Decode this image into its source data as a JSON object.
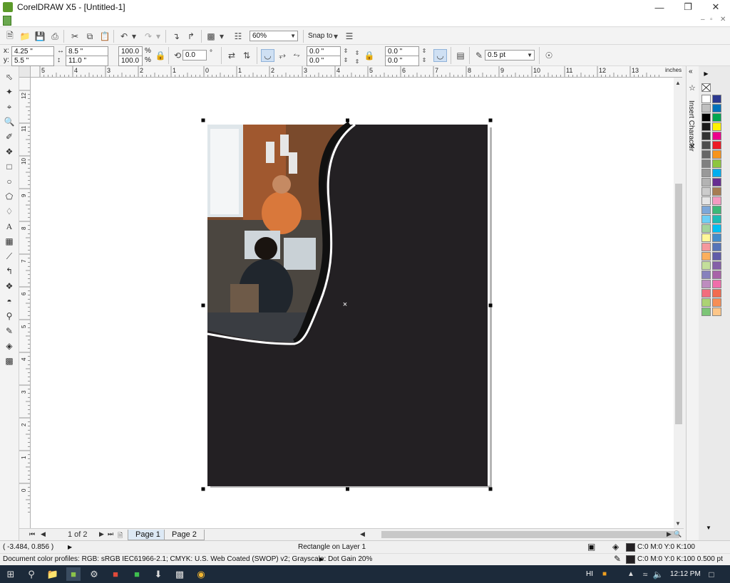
{
  "window": {
    "title": "CorelDRAW X5 - [Untitled-1]"
  },
  "standard_toolbar": {
    "zoom": "60%",
    "snap_to": "Snap to"
  },
  "property_bar": {
    "x": "4.25 \"",
    "y": "5.5 \"",
    "width": "8.5 \"",
    "height": "11.0 \"",
    "scale_w": "100.0",
    "scale_h": "100.0",
    "percent": "%",
    "rotation": "0.0",
    "degree": "°",
    "corner_tl": "0.0 \"",
    "corner_bl": "0.0 \"",
    "corner_tr": "0.0 \"",
    "corner_br": "0.0 \"",
    "outline_width": "0.5 pt"
  },
  "rulers": {
    "unit": "inches",
    "h_ticks": [
      "5",
      "4",
      "3",
      "2",
      "1",
      "0",
      "1",
      "2",
      "3",
      "4",
      "5",
      "6",
      "7",
      "8",
      "9",
      "10",
      "11",
      "12",
      "13"
    ],
    "v_ticks": [
      "12",
      "11",
      "10",
      "9",
      "8",
      "7",
      "6",
      "5",
      "4",
      "3",
      "2",
      "1",
      "0"
    ]
  },
  "docker": {
    "label": "Insert Character"
  },
  "pages": {
    "counter": "1 of 2",
    "tabs": [
      "Page 1",
      "Page 2"
    ]
  },
  "status": {
    "cursor": "( -3.484, 0.856 )",
    "selection": "Rectangle on Layer 1",
    "fill": "C:0 M:0 Y:0 K:100",
    "outline": "C:0 M:0 Y:0 K:100  0.500 pt",
    "color_profiles": "Document color profiles: RGB: sRGB IEC61966-2.1; CMYK: U.S. Web Coated (SWOP) v2; Grayscale: Dot Gain 20%"
  },
  "taskbar": {
    "lang": "HI",
    "time": "12:12 PM"
  },
  "colors": {
    "page_fill": "#232023",
    "accent": "#cfe0f3",
    "taskbar": "#1c2a3a"
  },
  "palette": [
    "#ffffff",
    "#c0c0c0",
    "#000000",
    "#1a1a1a",
    "#333333",
    "#4d4d4d",
    "#666666",
    "#808080",
    "#999999",
    "#b3b3b3",
    "#cccccc",
    "#e6e6e6",
    "#2b3990",
    "#0072bc",
    "#00a651",
    "#fff200",
    "#ec008c",
    "#ed1c24",
    "#f7941d",
    "#8dc63f",
    "#00aeef",
    "#662d91",
    "#a67c52",
    "#f49ac1",
    "#7da7d9",
    "#6dcff6",
    "#a3d39c",
    "#fff799",
    "#f5989d",
    "#fbaf5d",
    "#c4df9b",
    "#8781bd",
    "#bd8cbf",
    "#f26d7d",
    "#acd373",
    "#7cc576",
    "#3cb878",
    "#1cbbb4",
    "#00bff3",
    "#448ccb",
    "#5674b9",
    "#605ca8",
    "#855fa8",
    "#a864a8",
    "#f06eaa",
    "#f26c4f",
    "#f68e56",
    "#fdc689"
  ]
}
